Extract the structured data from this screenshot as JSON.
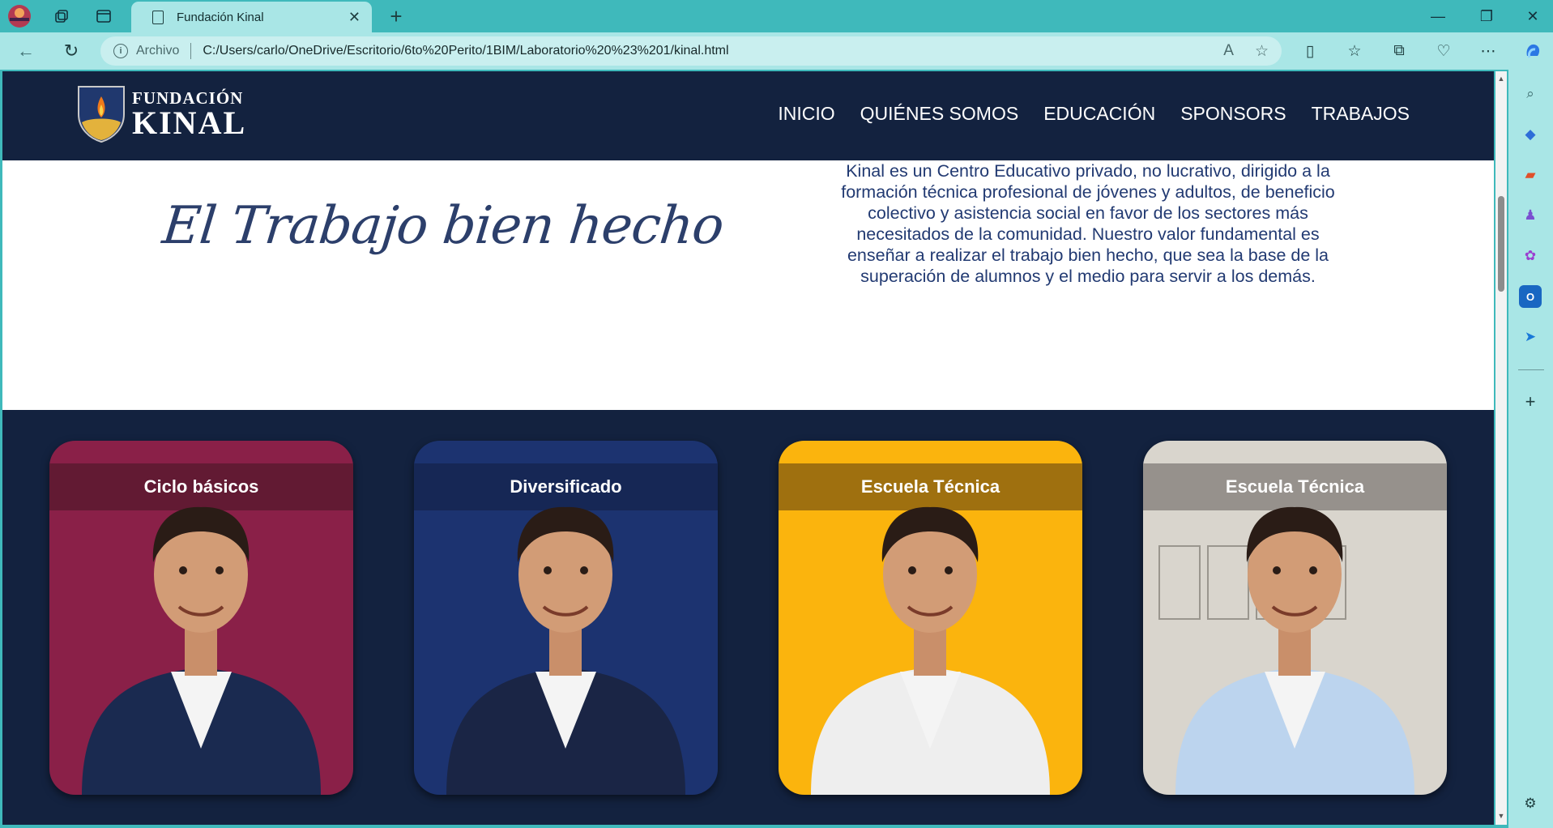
{
  "browser": {
    "tab_title": "Fundación Kinal",
    "address_label": "Archivo",
    "url": "C:/Users/carlo/OneDrive/Escritorio/6to%20Perito/1BIM/Laboratorio%20%23%201/kinal.html"
  },
  "site": {
    "logo_line1": "FUNDACIÓN",
    "logo_line2": "KINAL",
    "nav": [
      "INICIO",
      "QUIÉNES SOMOS",
      "EDUCACIÓN",
      "SPONSORS",
      "TRABAJOS"
    ],
    "tagline": "El Trabajo bien hecho",
    "intro_lines": [
      "Kinal es un Centro Educativo privado, no lucrativo, dirigido a la",
      "formación técnica profesional de jóvenes y adultos, de beneficio",
      "colectivo y asistencia social en favor de los sectores más",
      "necesitados de la comunidad. Nuestro valor fundamental es",
      "enseñar a realizar el trabajo bien hecho, que sea la base de la",
      "superación de alumnos y el medio para servir a los demás."
    ],
    "cards": [
      {
        "title": "Ciclo básicos",
        "bg": "#8a2048",
        "band": "#5a1a30",
        "shirt": "#1a2a50",
        "bg_name": "magenta"
      },
      {
        "title": "Diversificado",
        "bg": "#1c3370",
        "band": "#152650",
        "shirt": "#1a2545",
        "bg_name": "navy"
      },
      {
        "title": "Escuela Técnica",
        "bg": "#fbb40d",
        "band": "#8e6410",
        "shirt": "#eeeeee",
        "bg_name": "yellow"
      },
      {
        "title": "Escuela Técnica",
        "bg": "#d9d5cd",
        "band": "#8a8580",
        "shirt": "#bcd4ee",
        "bg_name": "gray"
      }
    ],
    "colors": {
      "header": "#13223f",
      "text_blue": "#223a72"
    }
  }
}
